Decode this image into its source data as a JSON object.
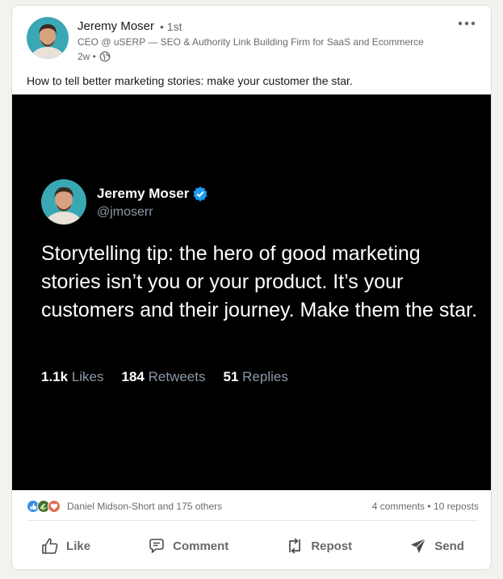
{
  "post": {
    "author": {
      "name": "Jeremy Moser",
      "degree": "• 1st",
      "headline": "CEO @ uSERP — SEO & Authority Link Building Firm for SaaS and Ecommerce",
      "time": "2w •"
    },
    "text": "How to tell better marketing stories: make your customer the star."
  },
  "tweet": {
    "name": "Jeremy Moser",
    "handle": "@jmoserr",
    "text": "Storytelling tip: the hero of good marketing stories isn’t you or your product. It’s your customers and their journey. Make them the star.",
    "stats": [
      {
        "value": "1.1k",
        "label": "Likes"
      },
      {
        "value": "184",
        "label": "Retweets"
      },
      {
        "value": "51",
        "label": "Replies"
      }
    ]
  },
  "social": {
    "reactor": "Daniel Midson-Short and 175 others",
    "comments": "4 comments",
    "separator": "•",
    "reposts": "10 reposts"
  },
  "actions": {
    "like": "Like",
    "comment": "Comment",
    "repost": "Repost",
    "send": "Send"
  },
  "icons": [
    "more-icon",
    "globe-icon",
    "verified-badge-icon",
    "like-reaction-icon",
    "celebrate-reaction-icon",
    "love-reaction-icon",
    "like-icon",
    "comment-icon",
    "repost-icon",
    "send-icon"
  ],
  "colors": {
    "verified": "#1d9bf0",
    "tweet_bg": "#000000",
    "tweet_secondary": "#8b98a5"
  }
}
